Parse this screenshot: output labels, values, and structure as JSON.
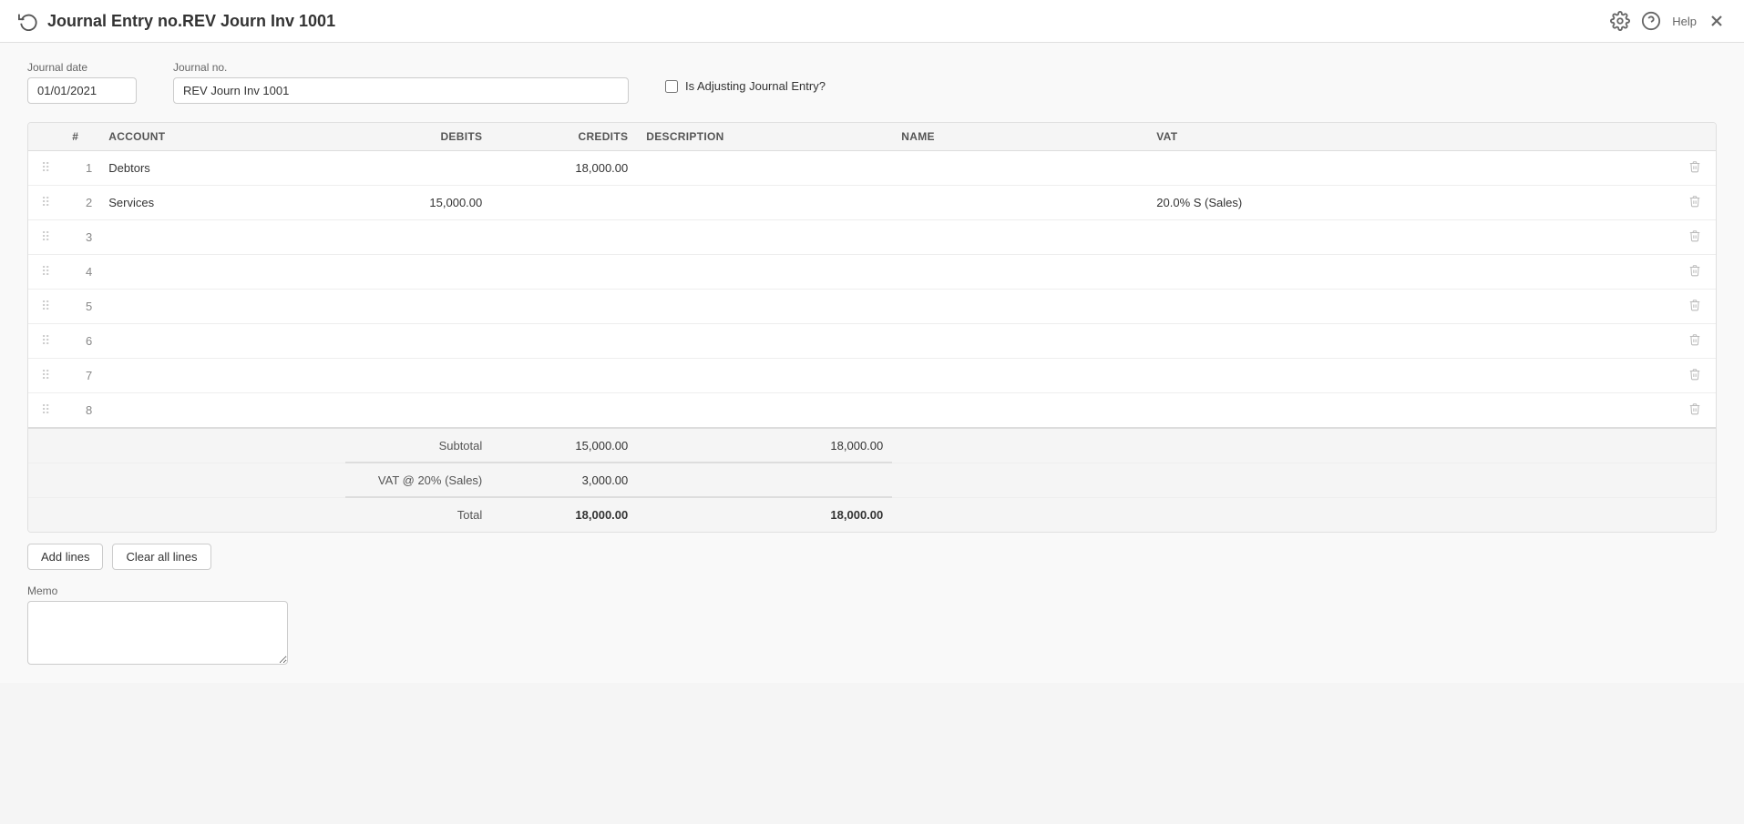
{
  "titleBar": {
    "title": "Journal Entry no.REV Journ Inv 1001",
    "helpLabel": "Help"
  },
  "form": {
    "journalDateLabel": "Journal date",
    "journalDateValue": "01/01/2021",
    "journalNoLabel": "Journal no.",
    "journalNoValue": "REV Journ Inv 1001",
    "isAdjustingLabel": "Is Adjusting Journal Entry?"
  },
  "table": {
    "columns": {
      "drag": "",
      "num": "#",
      "account": "ACCOUNT",
      "debits": "DEBITS",
      "credits": "CREDITS",
      "description": "DESCRIPTION",
      "name": "NAME",
      "vat": "VAT"
    },
    "rows": [
      {
        "num": 1,
        "account": "Debtors",
        "debits": "",
        "credits": "18,000.00",
        "description": "",
        "name": "",
        "vat": ""
      },
      {
        "num": 2,
        "account": "Services",
        "debits": "15,000.00",
        "credits": "",
        "description": "",
        "name": "",
        "vat": "20.0% S (Sales)"
      },
      {
        "num": 3,
        "account": "",
        "debits": "",
        "credits": "",
        "description": "",
        "name": "",
        "vat": ""
      },
      {
        "num": 4,
        "account": "",
        "debits": "",
        "credits": "",
        "description": "",
        "name": "",
        "vat": ""
      },
      {
        "num": 5,
        "account": "",
        "debits": "",
        "credits": "",
        "description": "",
        "name": "",
        "vat": ""
      },
      {
        "num": 6,
        "account": "",
        "debits": "",
        "credits": "",
        "description": "",
        "name": "",
        "vat": ""
      },
      {
        "num": 7,
        "account": "",
        "debits": "",
        "credits": "",
        "description": "",
        "name": "",
        "vat": ""
      },
      {
        "num": 8,
        "account": "",
        "debits": "",
        "credits": "",
        "description": "",
        "name": "",
        "vat": ""
      }
    ],
    "subtotal": {
      "label": "Subtotal",
      "debits": "15,000.00",
      "credits": "18,000.00"
    },
    "vatLine": {
      "label": "VAT @ 20% (Sales)",
      "debits": "3,000.00",
      "credits": ""
    },
    "total": {
      "label": "Total",
      "debits": "18,000.00",
      "credits": "18,000.00"
    }
  },
  "buttons": {
    "addLines": "Add lines",
    "clearAllLines": "Clear all lines"
  },
  "memo": {
    "label": "Memo",
    "placeholder": ""
  }
}
